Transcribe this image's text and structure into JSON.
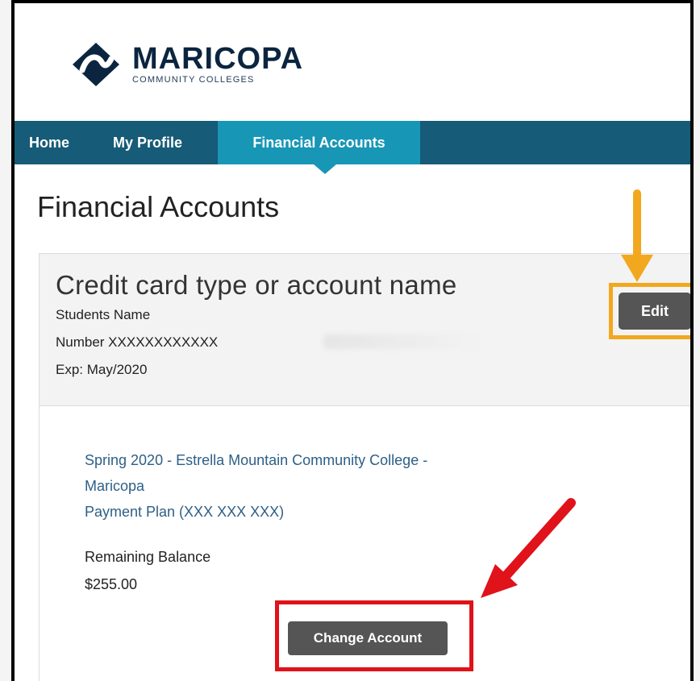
{
  "brand": {
    "name": "MARICOPA",
    "subtitle": "COMMUNITY COLLEGES",
    "logo_icon": "maricopa-logo-icon"
  },
  "nav": {
    "items": [
      {
        "label": "Home"
      },
      {
        "label": "My Profile"
      },
      {
        "label": "Financial Accounts",
        "active": true
      }
    ]
  },
  "page": {
    "title": "Financial Accounts"
  },
  "account": {
    "name": "Credit card type or account name",
    "student": "Students Name",
    "number": "Number XXXXXXXXXXXX",
    "exp": "Exp: May/2020",
    "edit_label": "Edit"
  },
  "plan": {
    "line1": "Spring 2020 - Estrella Mountain Community College -",
    "line2": "Maricopa",
    "line3": "Payment Plan (XXX XXX XXX)",
    "remaining_label": "Remaining Balance",
    "remaining_value": "$255.00",
    "change_label": "Change Account"
  },
  "colors": {
    "nav_bg": "#165b77",
    "nav_active": "#1896b6",
    "edit_highlight": "#f2a81e",
    "change_highlight": "#e0121a",
    "button": "#555555"
  }
}
